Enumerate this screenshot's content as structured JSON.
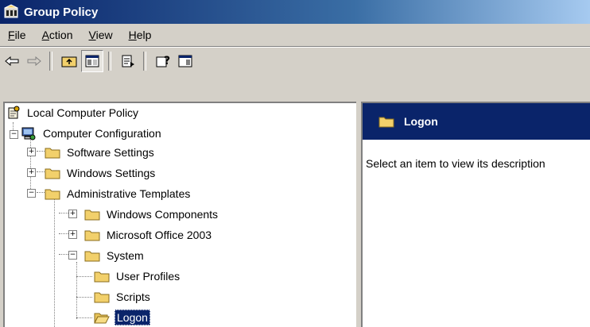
{
  "window": {
    "title": "Group Policy"
  },
  "menu": {
    "file": "File",
    "action": "Action",
    "view": "View",
    "help": "Help",
    "file_key": "F",
    "file_rest": "ile",
    "action_key": "A",
    "action_rest": "ction",
    "view_key": "V",
    "view_rest": "iew",
    "help_key": "H",
    "help_rest": "elp"
  },
  "toolbar": {
    "icons": [
      "back-arrow-icon",
      "forward-arrow-icon",
      "up-folder-icon",
      "show-hide-tree-icon",
      "export-list-icon",
      "help-icon",
      "show-hide-action-pane-icon"
    ]
  },
  "tree": {
    "root": "Local Computer Policy",
    "computer_config": "Computer Configuration",
    "software_settings": "Software Settings",
    "windows_settings": "Windows Settings",
    "admin_templates": "Administrative Templates",
    "windows_components": "Windows Components",
    "office_2003": "Microsoft Office 2003",
    "system": "System",
    "user_profiles": "User Profiles",
    "scripts": "Scripts",
    "logon": "Logon"
  },
  "details": {
    "header_title": "Logon",
    "description": "Select an item to view its description"
  },
  "colors": {
    "title_bar": "#0a246a",
    "selection": "#0a246a",
    "folder": "#f2d06b"
  }
}
